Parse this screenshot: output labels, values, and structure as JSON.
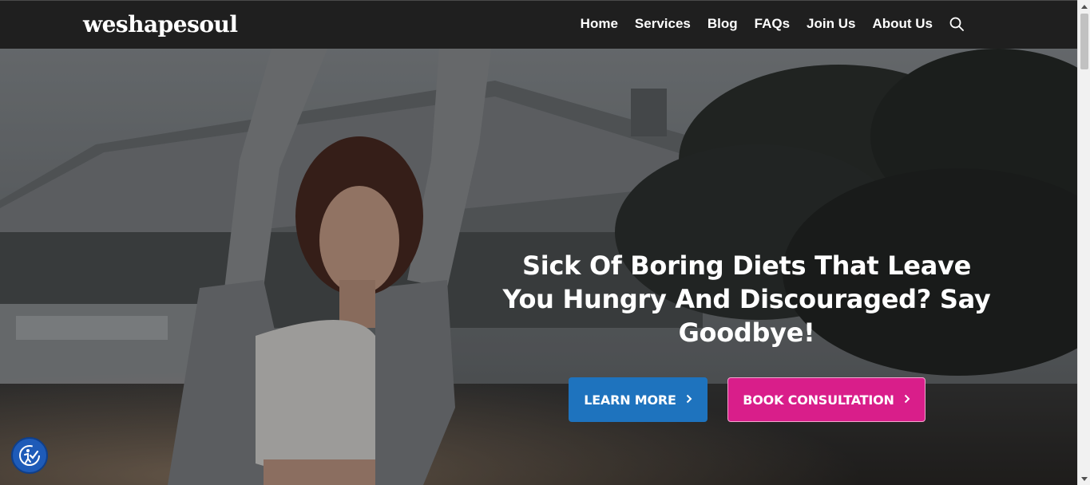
{
  "brand": {
    "logo": "weshapesoul"
  },
  "nav": {
    "items": [
      {
        "label": "Home"
      },
      {
        "label": "Services"
      },
      {
        "label": "Blog"
      },
      {
        "label": "FAQs"
      },
      {
        "label": "Join Us"
      },
      {
        "label": "About Us"
      }
    ],
    "search_icon": "search-icon"
  },
  "hero": {
    "headline": "Sick Of Boring Diets That Leave You Hungry And Discouraged? Say Goodbye!",
    "buttons": {
      "learn_more": "LEARN MORE",
      "book_consultation": "BOOK CONSULTATION"
    },
    "image": "woman-stretching-photo"
  },
  "accessibility": {
    "icon": "accessibility-icon"
  },
  "colors": {
    "navbar_bg": "#1f1f1f",
    "learn_more_bg": "#1e73be",
    "book_bg": "#d91e8a"
  }
}
